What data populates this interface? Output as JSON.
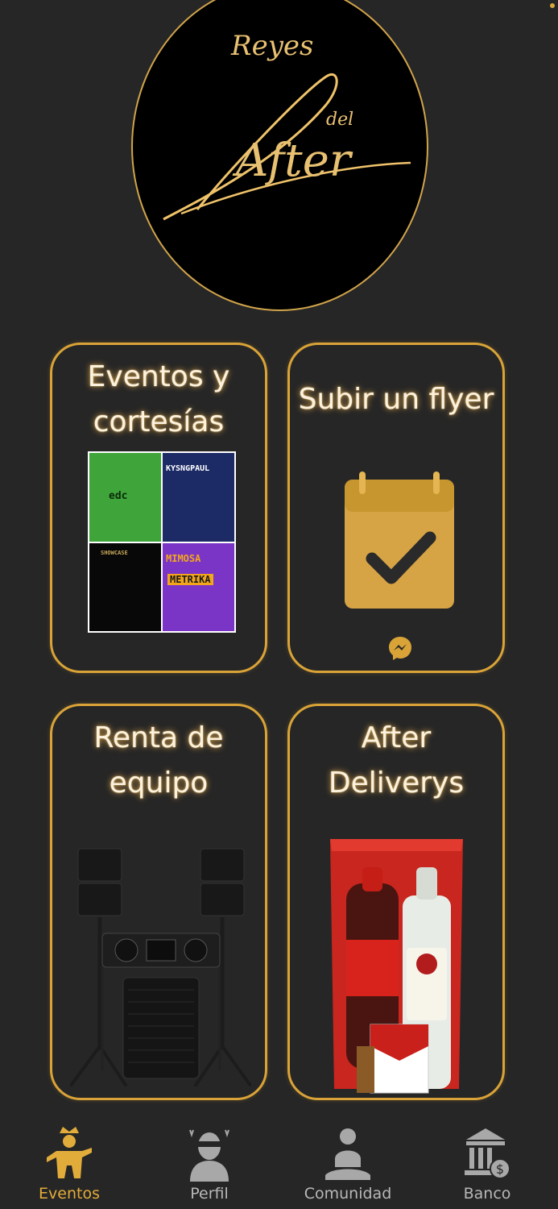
{
  "app": {
    "logo_text": [
      "Reyes",
      "del",
      "After"
    ]
  },
  "cards": [
    {
      "title": "Eventos y\ncortesías"
    },
    {
      "title": "Subir un flyer"
    },
    {
      "title": "Renta de\nequipo"
    },
    {
      "title": "After\nDeliverys"
    }
  ],
  "posters": {
    "edc": "edc",
    "kys": "KYSNGPAUL",
    "show": "SHOWCASE",
    "mimosa": "MIMOSA",
    "metrika": "METRIKA"
  },
  "nav": {
    "items": [
      {
        "label": "Eventos",
        "active": true
      },
      {
        "label": "Perfil"
      },
      {
        "label": "Comunidad"
      },
      {
        "label": "Banco"
      }
    ]
  },
  "colors": {
    "background": "#262626",
    "accent_gold": "#d9a337",
    "nav_inactive": "#b8b8b8"
  },
  "icons": [
    "calendar-check-icon",
    "messenger-icon",
    "king-icon",
    "profile-icon",
    "meditation-icon",
    "bank-icon"
  ]
}
